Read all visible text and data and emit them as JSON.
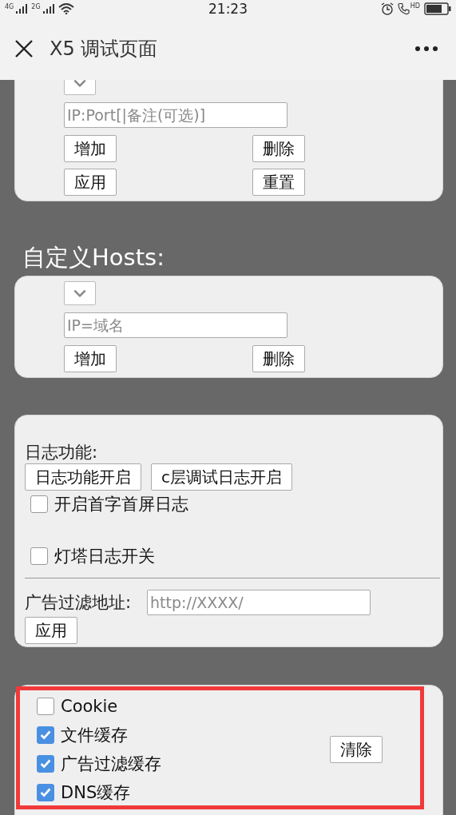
{
  "status_bar": {
    "network_1": "4G",
    "network_2": "2G",
    "time": "21:23",
    "call_badge": "HD"
  },
  "header": {
    "title": "X5 调试页面"
  },
  "proxy_card": {
    "input": {
      "placeholder": "IP:Port[|备注(可选)]"
    },
    "buttons": [
      "增加",
      "删除",
      "应用",
      "重置"
    ]
  },
  "hosts_section": {
    "heading": "自定义Hosts:",
    "input": {
      "placeholder": "IP=域名"
    },
    "buttons": [
      "增加",
      "删除"
    ]
  },
  "log_card": {
    "label": "日志功能:",
    "buttons": [
      "日志功能开启",
      "c层调试日志开启"
    ],
    "options": [
      {
        "label": "开启首字首屏日志",
        "checked": false
      },
      {
        "label": "灯塔日志开关",
        "checked": false
      }
    ],
    "ad_filter": {
      "label": "广告过滤地址:",
      "placeholder": "http://XXXX/",
      "button": "应用"
    }
  },
  "cache_card": {
    "highlighted": true,
    "options": [
      {
        "label": "Cookie",
        "checked": false
      },
      {
        "label": "文件缓存",
        "checked": true
      },
      {
        "label": "广告过滤缓存",
        "checked": true
      },
      {
        "label": "DNS缓存",
        "checked": true
      }
    ],
    "button": "清除"
  }
}
